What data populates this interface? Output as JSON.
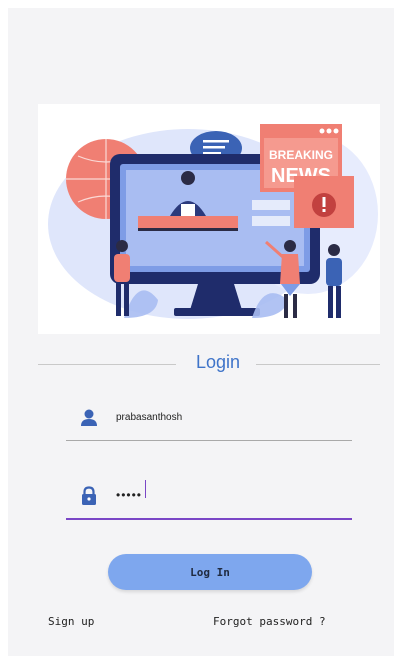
{
  "hero": {
    "banner_line1": "BREAKING",
    "banner_line2": "NEWS"
  },
  "login": {
    "title": "Login",
    "username_value": "prabasanthosh",
    "password_value": "•••••",
    "login_button_label": "Log In",
    "signup_label": "Sign up",
    "forgot_label": "Forgot password ?"
  },
  "colors": {
    "accent": "#7a46c6",
    "title_blue": "#3f74c9",
    "button_blue": "#7ea7ee",
    "icon_blue": "#3b63b5",
    "banner_coral": "#f07f73"
  },
  "icons": {
    "user": "user-icon",
    "lock": "lock-icon"
  }
}
